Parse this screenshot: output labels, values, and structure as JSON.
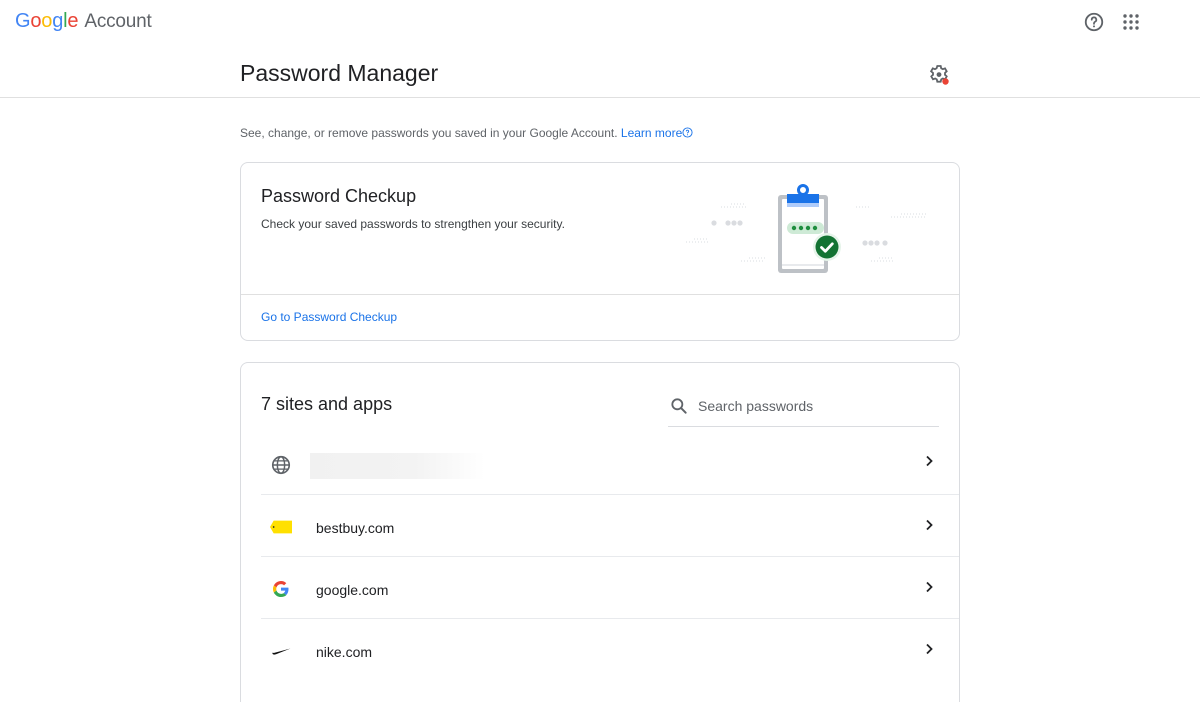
{
  "topbar": {
    "logo_letters": [
      "G",
      "o",
      "o",
      "g",
      "l",
      "e"
    ],
    "logo_suffix": "Account",
    "icons": {
      "help": "help-circle-icon",
      "apps": "apps-grid-icon"
    }
  },
  "header": {
    "title": "Password Manager",
    "settings_icon": "gear-icon",
    "settings_badge_color": "#ea4335"
  },
  "intro": {
    "text": "See, change, or remove passwords you saved in your Google Account.",
    "link": "Learn more"
  },
  "checkup": {
    "title": "Password Checkup",
    "description": "Check your saved passwords to strengthen your security.",
    "link": "Go to Password Checkup"
  },
  "passwords": {
    "title": "7 sites and apps",
    "search_placeholder": "Search passwords",
    "search_value": "",
    "items": [
      {
        "name": "",
        "icon": "globe-icon",
        "redacted": true
      },
      {
        "name": "bestbuy.com",
        "icon": "bestbuy-tag-icon"
      },
      {
        "name": "google.com",
        "icon": "google-g-icon"
      },
      {
        "name": "nike.com",
        "icon": "nike-swoosh-icon"
      }
    ]
  },
  "colors": {
    "accent": "#1a73e8",
    "text_primary": "#202124",
    "text_secondary": "#5f6368",
    "check_green": "#188038",
    "clipboard_blue": "#1a73e8"
  }
}
